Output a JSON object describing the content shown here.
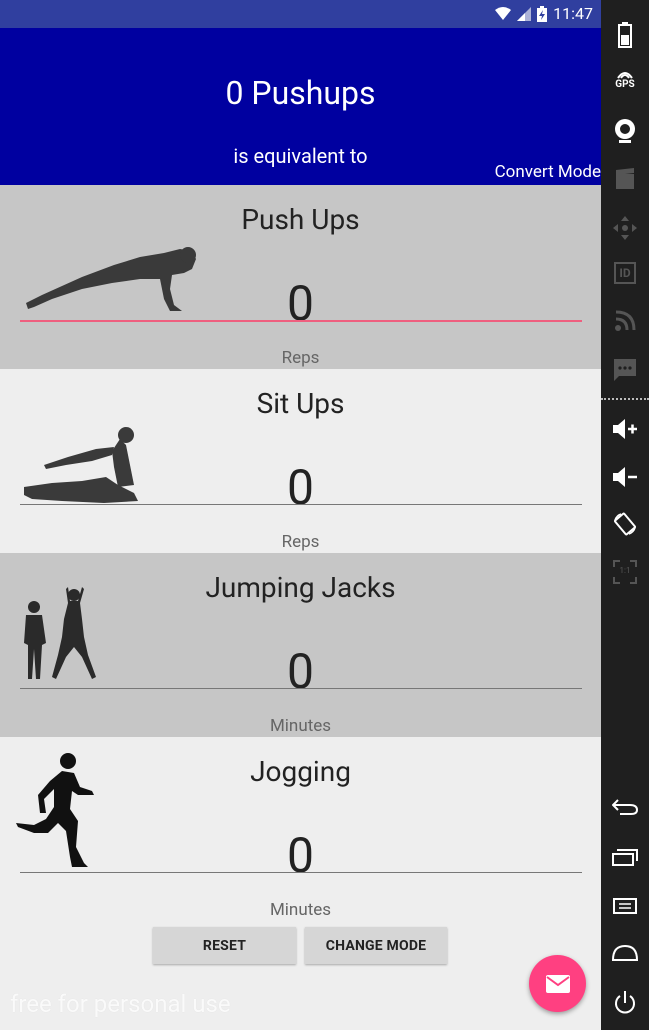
{
  "status_bar": {
    "time": "11:47"
  },
  "header": {
    "title": "0 Pushups",
    "subtitle": "is equivalent to",
    "convert_label": "Convert Mode"
  },
  "exercises": [
    {
      "name": "Push Ups",
      "value": "0",
      "unit": "Reps"
    },
    {
      "name": "Sit Ups",
      "value": "0",
      "unit": "Reps"
    },
    {
      "name": "Jumping Jacks",
      "value": "0",
      "unit": "Minutes"
    },
    {
      "name": "Jogging",
      "value": "0",
      "unit": "Minutes"
    }
  ],
  "buttons": {
    "reset": "RESET",
    "change_mode": "CHANGE MODE"
  },
  "watermark": "free for personal use",
  "colors": {
    "header": "#0000a0",
    "status": "#303f9f",
    "accent": "#ff4081"
  },
  "emulator_sidebar": {
    "gps_label": "GPS",
    "id_label": "ID",
    "scale_label": "1:1",
    "icons": [
      "battery-icon",
      "gps-icon",
      "camera-icon",
      "media-icon",
      "dpad-icon",
      "id-icon",
      "cellular-icon",
      "messages-icon",
      "volume-up-icon",
      "volume-down-icon",
      "rotate-icon",
      "scale-icon",
      "back-icon",
      "overview-icon",
      "menu-icon",
      "home-icon",
      "power-icon"
    ]
  }
}
